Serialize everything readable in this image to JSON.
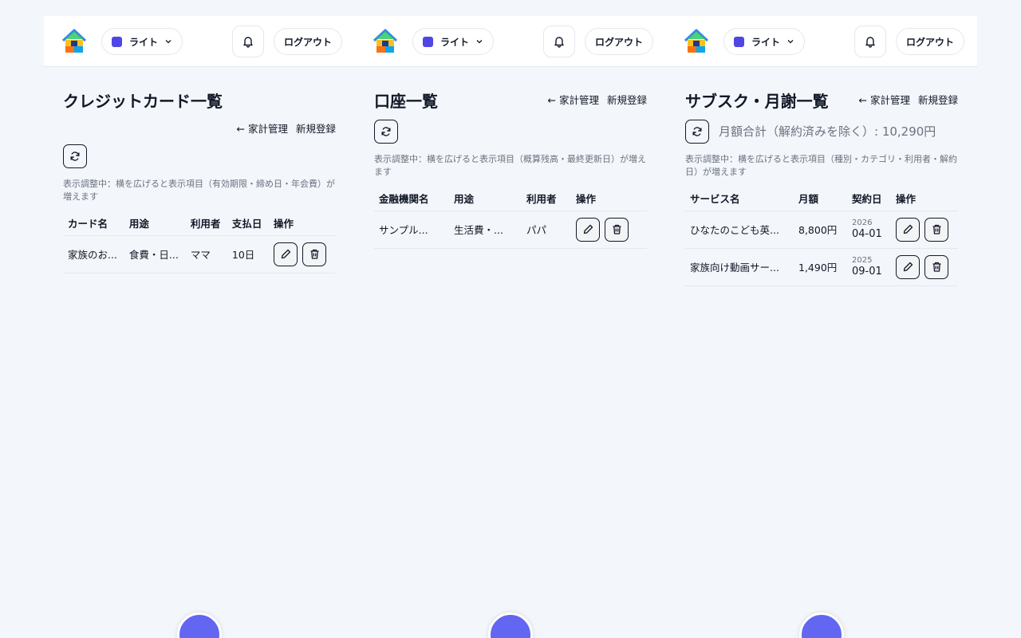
{
  "common": {
    "theme_label": "ライト",
    "logout_label": "ログアウト",
    "back_link": "家計管理",
    "new_link": "新規登録",
    "accent_color": "#4f46e5"
  },
  "cards": {
    "title": "クレジットカード一覧",
    "note": "表示調整中：横を広げると表示項目（有効期限・締め日・年会費）が増えます",
    "headers": [
      "カード名",
      "用途",
      "利用者",
      "支払日",
      "操作"
    ],
    "rows": [
      {
        "name": "家族のお...",
        "use": "食費・日...",
        "user": "ママ",
        "pay_day": "10日"
      }
    ]
  },
  "accounts": {
    "title": "口座一覧",
    "note": "表示調整中：横を広げると表示項目（概算残高・最終更新日）が増えます",
    "headers": [
      "金融機関名",
      "用途",
      "利用者",
      "操作"
    ],
    "rows": [
      {
        "name": "サンプル...",
        "use": "生活費・...",
        "user": "パパ"
      }
    ]
  },
  "subs": {
    "title": "サブスク・月謝一覧",
    "total": "月額合計（解約済みを除く）: 10,290円",
    "note": "表示調整中：横を広げると表示項目（種別・カテゴリ・利用者・解約日）が増えます",
    "headers": [
      "サービス名",
      "月額",
      "契約日",
      "操作"
    ],
    "rows": [
      {
        "name": "ひなたのこども英...",
        "amount": "8,800円",
        "year": "2026",
        "date": "04-01"
      },
      {
        "name": "家族向け動画サー...",
        "amount": "1,490円",
        "year": "2025",
        "date": "09-01"
      }
    ]
  }
}
